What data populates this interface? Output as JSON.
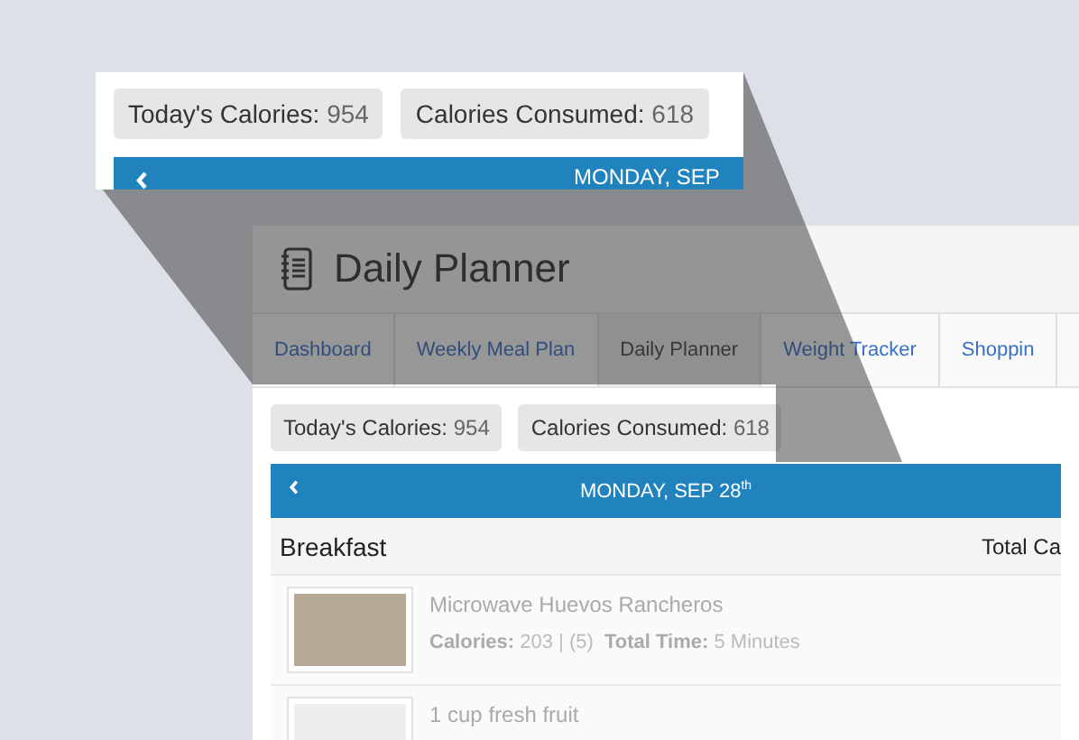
{
  "callout": {
    "stats": [
      {
        "label": "Today's Calories:",
        "value": "954"
      },
      {
        "label": "Calories Consumed:",
        "value": "618"
      }
    ],
    "date": "MONDAY, SEP"
  },
  "app": {
    "title": "Daily Planner",
    "tabs": [
      {
        "label": "Dashboard",
        "selected": false
      },
      {
        "label": "Weekly Meal Plan",
        "selected": false
      },
      {
        "label": "Daily Planner",
        "selected": true
      },
      {
        "label": "Weight Tracker",
        "selected": false
      },
      {
        "label": "Shoppin",
        "selected": false
      }
    ],
    "stats": [
      {
        "label": "Today's Calories:",
        "value": "954"
      },
      {
        "label": "Calories Consumed:",
        "value": "618"
      }
    ],
    "date": "MONDAY, SEP 28$^{th}$",
    "meal": {
      "name": "Breakfast",
      "total_label": "Total Ca"
    },
    "items": [
      {
        "name": "Microwave Huevos Rancheros",
        "details": "**Calories:** 203 | (5)  **Total Time:** 5 Minutes"
      },
      {
        "name": "1 cup fresh fruit"
      }
    ]
  }
}
